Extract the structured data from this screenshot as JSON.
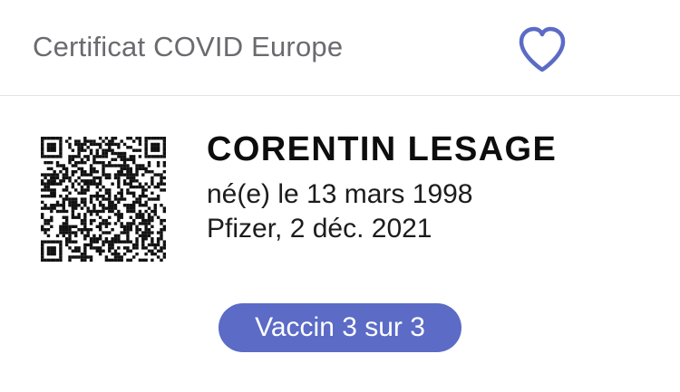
{
  "header": {
    "title": "Certificat COVID Europe",
    "favorite_icon": "heart-outline-icon",
    "accent_color": "#5b6bc6"
  },
  "certificate": {
    "holder_name": "CORENTIN LESAGE",
    "birth_line": "né(e) le 13 mars 1998",
    "vaccine_line": "Pfizer, 2 déc. 2021",
    "qr_icon": "qr-code-icon"
  },
  "badge": {
    "label": "Vaccin 3 sur 3",
    "color": "#5b6bc6"
  }
}
